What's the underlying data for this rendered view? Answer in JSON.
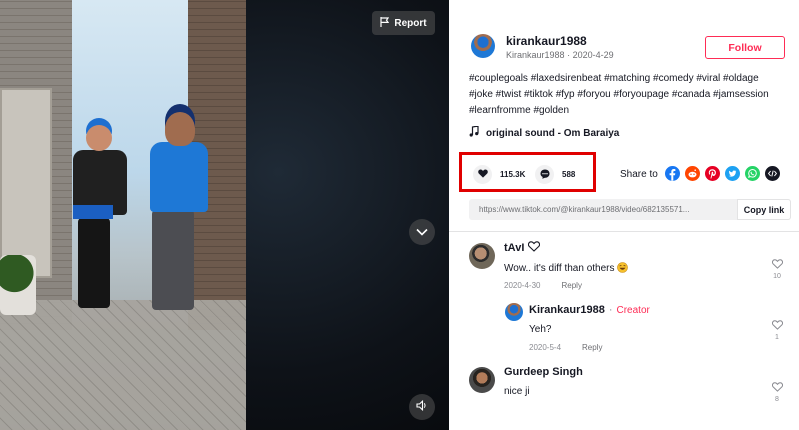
{
  "video": {
    "report_label": "Report"
  },
  "author": {
    "username": "kirankaur1988",
    "display_name": "Kirankaur1988",
    "date": "2020-4-29",
    "follow_label": "Follow"
  },
  "description": "#couplegoals #laxedsirenbeat #matching #comedy #viral #oldage #joke #twist #tiktok #fyp #foryou #foryoupage #canada #jamsession #learnfromme #golden",
  "music": {
    "title": "original sound - Om Baraiya"
  },
  "stats": {
    "likes": "115.3K",
    "comments": "588"
  },
  "share": {
    "label": "Share to",
    "platforms": [
      {
        "name": "facebook-icon",
        "color": "#1877f2"
      },
      {
        "name": "reddit-icon",
        "color": "#ff4500"
      },
      {
        "name": "pinterest-icon",
        "color": "#e60023"
      },
      {
        "name": "twitter-icon",
        "color": "#1da1f2"
      },
      {
        "name": "whatsapp-icon",
        "color": "#25d366"
      },
      {
        "name": "embed-icon",
        "color": "#161823"
      }
    ]
  },
  "link": {
    "url": "https://www.tiktok.com/@kirankaur1988/video/682135571...",
    "copy_label": "Copy link"
  },
  "comments": [
    {
      "name": "tAvI",
      "text": "Wow.. it's diff than others",
      "date": "2020-4-30",
      "reply_label": "Reply",
      "likes": "10",
      "replies": [
        {
          "name": "Kirankaur1988",
          "badge": "Creator",
          "text": "Yeh?",
          "date": "2020-5-4",
          "reply_label": "Reply",
          "likes": "1"
        }
      ]
    },
    {
      "name": "Gurdeep Singh",
      "text": "nice ji",
      "likes": "8"
    }
  ],
  "colors": {
    "accent": "#fe2c55",
    "highlight_box": "#e00000"
  }
}
